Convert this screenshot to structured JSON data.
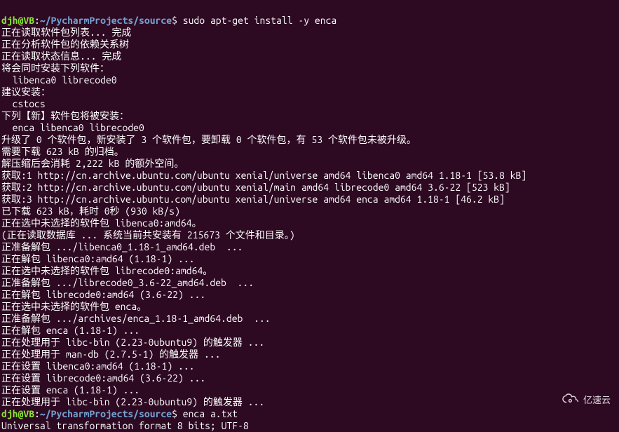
{
  "prompts": {
    "line1": {
      "user": "djh@VB",
      "colon": ":",
      "path": "~/PycharmProjects/source",
      "dollar": "$",
      "command": " sudo apt-get install -y enca"
    },
    "line2": {
      "user": "djh@VB",
      "colon": ":",
      "path": "~/PycharmProjects/source",
      "dollar": "$",
      "command": " enca a.txt"
    }
  },
  "output": {
    "l01": "正在读取软件包列表... 完成",
    "l02": "正在分析软件包的依赖关系树       ",
    "l03": "正在读取状态信息... 完成       ",
    "l04": "将会同时安装下列软件：",
    "l05": "  libenca0 librecode0",
    "l06": "建议安装：",
    "l07": "  cstocs",
    "l08": "下列【新】软件包将被安装：",
    "l09": "  enca libenca0 librecode0",
    "l10": "升级了 0 个软件包，新安装了 3 个软件包，要卸载 0 个软件包，有 53 个软件包未被升级。",
    "l11": "需要下载 623 kB 的归档。",
    "l12": "解压缩后会消耗 2,222 kB 的额外空间。",
    "l13": "获取:1 http://cn.archive.ubuntu.com/ubuntu xenial/universe amd64 libenca0 amd64 1.18-1 [53.8 kB]",
    "l14": "获取:2 http://cn.archive.ubuntu.com/ubuntu xenial/main amd64 librecode0 amd64 3.6-22 [523 kB]",
    "l15": "获取:3 http://cn.archive.ubuntu.com/ubuntu xenial/universe amd64 enca amd64 1.18-1 [46.2 kB]",
    "l16": "已下载 623 kB，耗时 0秒 (930 kB/s)",
    "l17": "正在选中未选择的软件包 libenca0:amd64。",
    "l18": "(正在读取数据库 ... 系统当前共安装有 215673 个文件和目录。)",
    "l19": "正准备解包 .../libenca0_1.18-1_amd64.deb  ...",
    "l20": "正在解包 libenca0:amd64 (1.18-1) ...",
    "l21": "正在选中未选择的软件包 librecode0:amd64。",
    "l22": "正准备解包 .../librecode0_3.6-22_amd64.deb  ...",
    "l23": "正在解包 librecode0:amd64 (3.6-22) ...",
    "l24": "正在选中未选择的软件包 enca。",
    "l25": "正准备解包 .../archives/enca_1.18-1_amd64.deb  ...",
    "l26": "正在解包 enca (1.18-1) ...",
    "l27": "正在处理用于 libc-bin (2.23-0ubuntu9) 的触发器 ...",
    "l28": "正在处理用于 man-db (2.7.5-1) 的触发器 ...",
    "l29": "正在设置 libenca0:amd64 (1.18-1) ...",
    "l30": "正在设置 librecode0:amd64 (3.6-22) ...",
    "l31": "正在设置 enca (1.18-1) ...",
    "l32": "正在处理用于 libc-bin (2.23-0ubuntu9) 的触发器 ...",
    "l33": "Universal transformation format 8 bits; UTF-8"
  },
  "watermark": {
    "text": "亿速云"
  }
}
